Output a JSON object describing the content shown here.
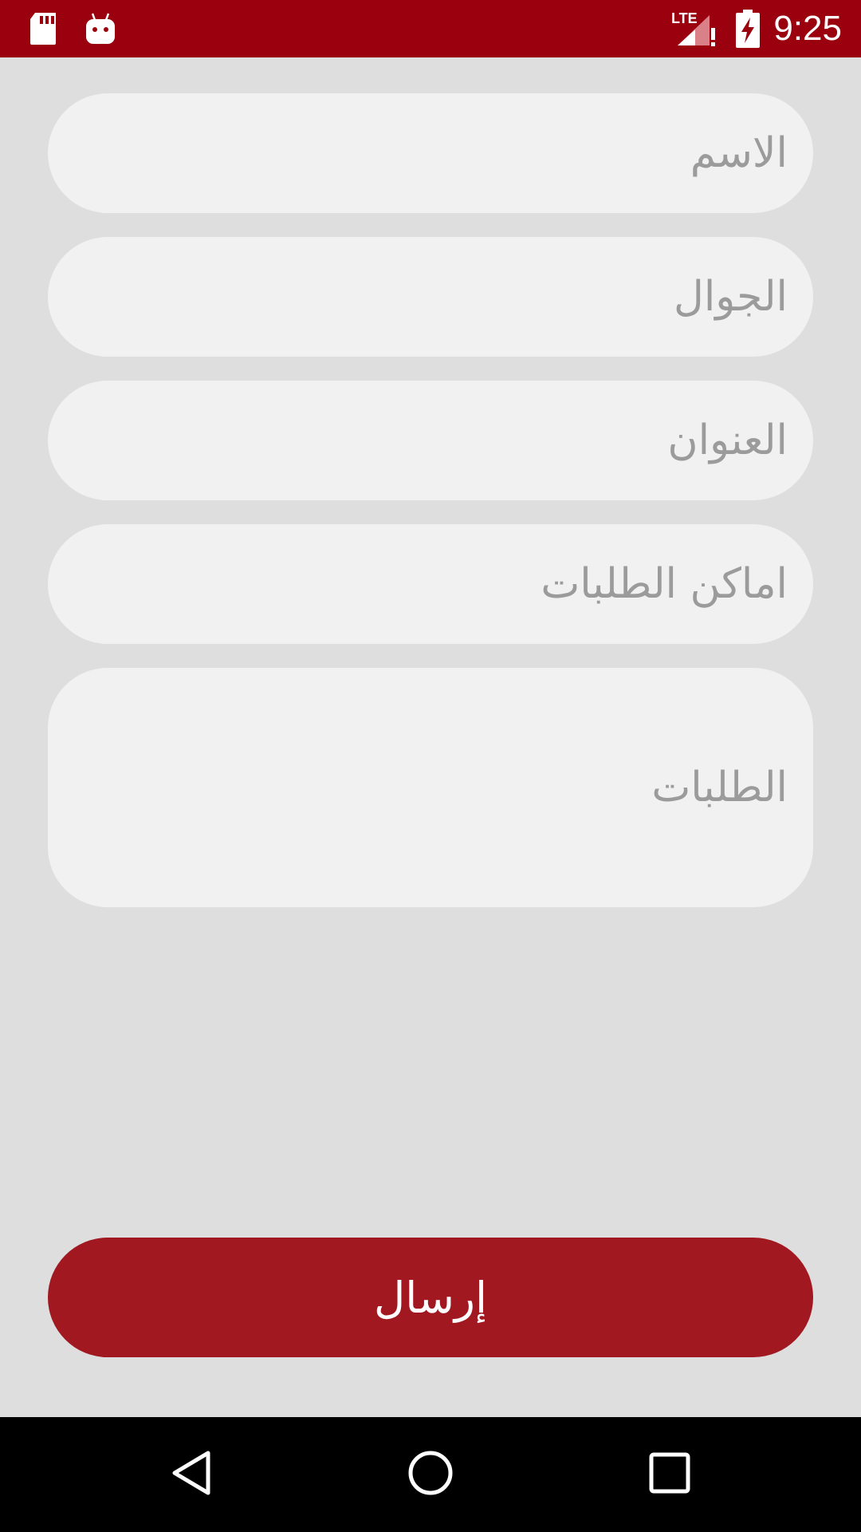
{
  "status_bar": {
    "time": "9:25",
    "network_label": "LTE",
    "icons": [
      "sd-card-icon",
      "android-debug-icon",
      "lte-signal-icon",
      "battery-charging-icon"
    ],
    "background_color": "#9a000d"
  },
  "form": {
    "fields": [
      {
        "placeholder": "الاسم",
        "value": ""
      },
      {
        "placeholder": "الجوال",
        "value": ""
      },
      {
        "placeholder": "العنوان",
        "value": ""
      },
      {
        "placeholder": "اماكن الطلبات",
        "value": ""
      },
      {
        "placeholder": "الطلبات",
        "value": ""
      }
    ],
    "field_color": "#f1f1f2",
    "placeholder_color": "#9b9b9b"
  },
  "submit": {
    "label": "إرسال",
    "color": "#a21820"
  },
  "nav_bar": {
    "icons": [
      "back-icon",
      "home-icon",
      "recents-icon"
    ]
  }
}
